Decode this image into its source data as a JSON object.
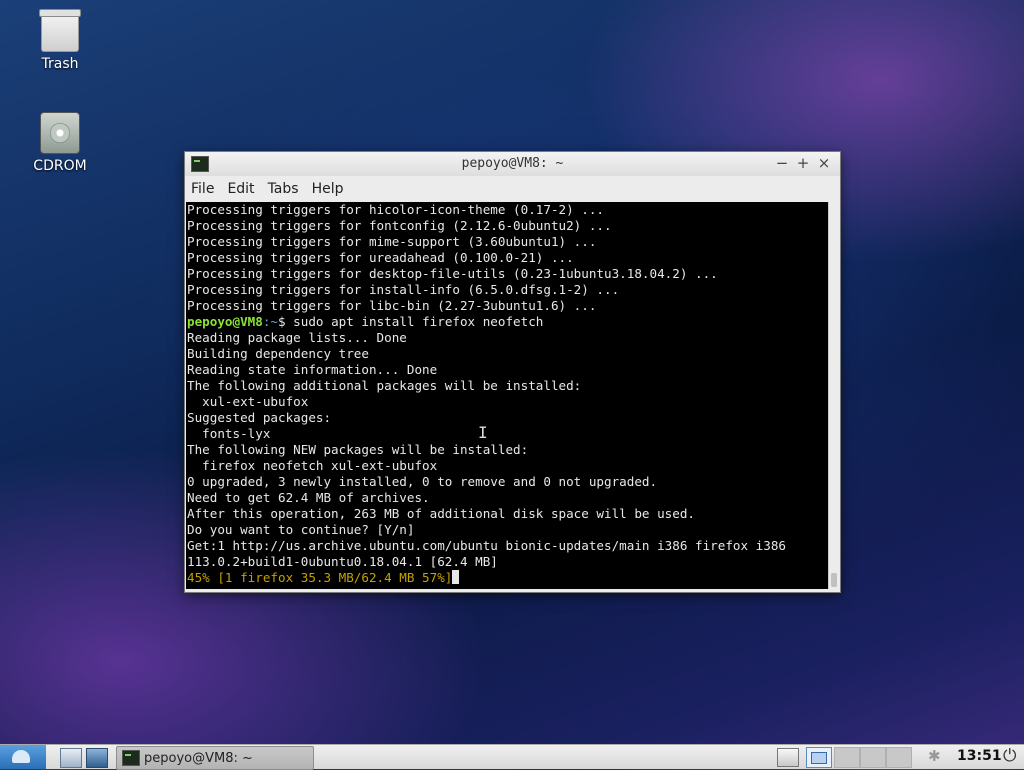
{
  "desktop": {
    "icons": [
      {
        "label": "Trash",
        "icon": "trash-icon"
      },
      {
        "label": "CDROM",
        "icon": "cdrom-icon"
      }
    ]
  },
  "window": {
    "title": "pepoyo@VM8: ~",
    "buttons": {
      "minimize": "−",
      "maximize": "+",
      "close": "×"
    },
    "menu": [
      "File",
      "Edit",
      "Tabs",
      "Help"
    ]
  },
  "terminal": {
    "lines_before_prompt": [
      "Processing triggers for hicolor-icon-theme (0.17-2) ...",
      "Processing triggers for fontconfig (2.12.6-0ubuntu2) ...",
      "Processing triggers for mime-support (3.60ubuntu1) ...",
      "Processing triggers for ureadahead (0.100.0-21) ...",
      "Processing triggers for desktop-file-utils (0.23-1ubuntu3.18.04.2) ...",
      "Processing triggers for install-info (6.5.0.dfsg.1-2) ...",
      "Processing triggers for libc-bin (2.27-3ubuntu1.6) ..."
    ],
    "prompt_user": "pepoyo@VM8",
    "prompt_path": ":~",
    "prompt_symbol": "$ ",
    "command": "sudo apt install firefox neofetch",
    "lines_after_prompt": [
      "Reading package lists... Done",
      "Building dependency tree",
      "Reading state information... Done",
      "The following additional packages will be installed:",
      "  xul-ext-ubufox",
      "Suggested packages:",
      "  fonts-lyx",
      "The following NEW packages will be installed:",
      "  firefox neofetch xul-ext-ubufox",
      "0 upgraded, 3 newly installed, 0 to remove and 0 not upgraded.",
      "Need to get 62.4 MB of archives.",
      "After this operation, 263 MB of additional disk space will be used.",
      "Do you want to continue? [Y/n]",
      "Get:1 http://us.archive.ubuntu.com/ubuntu bionic-updates/main i386 firefox i386",
      "113.0.2+build1-0ubuntu0.18.04.1 [62.4 MB]"
    ],
    "progress_line": "45% [1 firefox 35.3 MB/62.4 MB 57%]"
  },
  "taskbar": {
    "task_label": "pepoyo@VM8: ~",
    "clock": "13:51",
    "bluetooth_glyph": "✱",
    "power_glyph": "⏻"
  }
}
